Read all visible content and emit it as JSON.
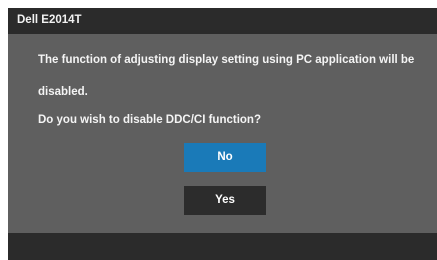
{
  "osd": {
    "title": "Dell E2014T",
    "message_line_1": "The function of adjusting display setting using PC application will be",
    "message_line_2": "disabled.",
    "question": "Do you wish to disable DDC/CI function?",
    "buttons": {
      "no_label": "No",
      "yes_label": "Yes"
    },
    "colors": {
      "background": "#5f5f5f",
      "title_bar": "#2b2b2b",
      "selected_button": "#1a7ab8",
      "unselected_button": "#2c2c2c",
      "text": "#f4f4f4"
    },
    "selected_button": "No"
  }
}
